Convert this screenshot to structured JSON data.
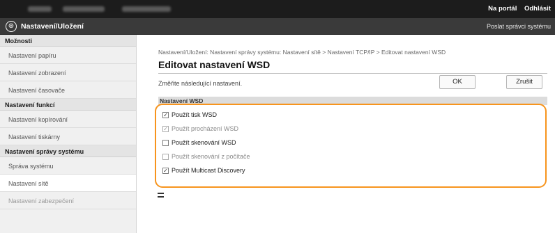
{
  "topbar": {
    "links": [
      "Na portál",
      "Odhlásit"
    ]
  },
  "appbar": {
    "logo_icon": "⊛",
    "title": "Nastavení/Uložení",
    "right_link": "Poslat správci systému"
  },
  "sidebar": {
    "groups": [
      {
        "heading": "Možnosti",
        "items": [
          "Nastavení papíru",
          "Nastavení zobrazení",
          "Nastavení časovače"
        ]
      },
      {
        "heading": "Nastavení funkcí",
        "items": [
          "Nastavení kopírování",
          "Nastavení tiskárny"
        ]
      },
      {
        "heading": "Nastavení správy systému",
        "items": [
          "Správa systému",
          "Nastavení sítě",
          "Nastavení zabezpečení"
        ]
      }
    ]
  },
  "main": {
    "breadcrumb": "Nastavení/Uložení: Nastavení správy systému: Nastavení sítě > Nastavení TCP/IP > Editovat nastavení WSD",
    "title": "Editovat nastavení WSD",
    "instruction": "Změňte následující nastavení.",
    "ok_label": "OK",
    "cancel_label": "Zrušit",
    "section_heading": "Nastavení WSD",
    "options": [
      {
        "label": "Použít tisk WSD",
        "checked": true,
        "disabled": false
      },
      {
        "label": "Použít procházení WSD",
        "checked": true,
        "disabled": true
      },
      {
        "label": "Použít skenování WSD",
        "checked": false,
        "disabled": false
      },
      {
        "label": "Použít skenování z počítače",
        "checked": false,
        "disabled": true
      },
      {
        "label": "Použít Multicast Discovery",
        "checked": true,
        "disabled": false
      }
    ],
    "highlight_color": "#f7941d"
  }
}
